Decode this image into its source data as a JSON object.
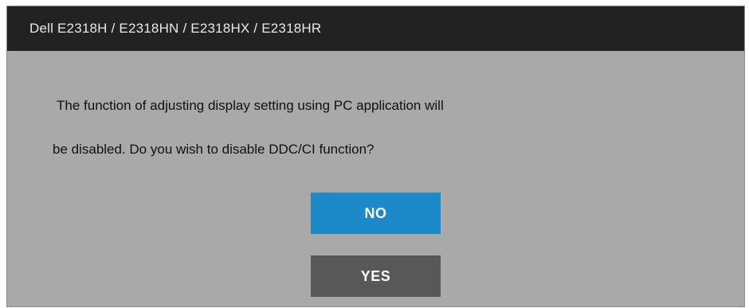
{
  "window": {
    "title": "Dell E2318H / E2318HN / E2318HX / E2318HR"
  },
  "dialog": {
    "message_line_1": "The function of adjusting display setting using PC application will",
    "message_line_2": "be disabled. Do you wish to disable DDC/CI function?",
    "buttons": {
      "no_label": "NO",
      "yes_label": "YES"
    }
  },
  "colors": {
    "title_bar": "#222222",
    "dialog_background": "#a9a9a9",
    "no_button": "#1c8ac8",
    "yes_button": "#585858"
  }
}
